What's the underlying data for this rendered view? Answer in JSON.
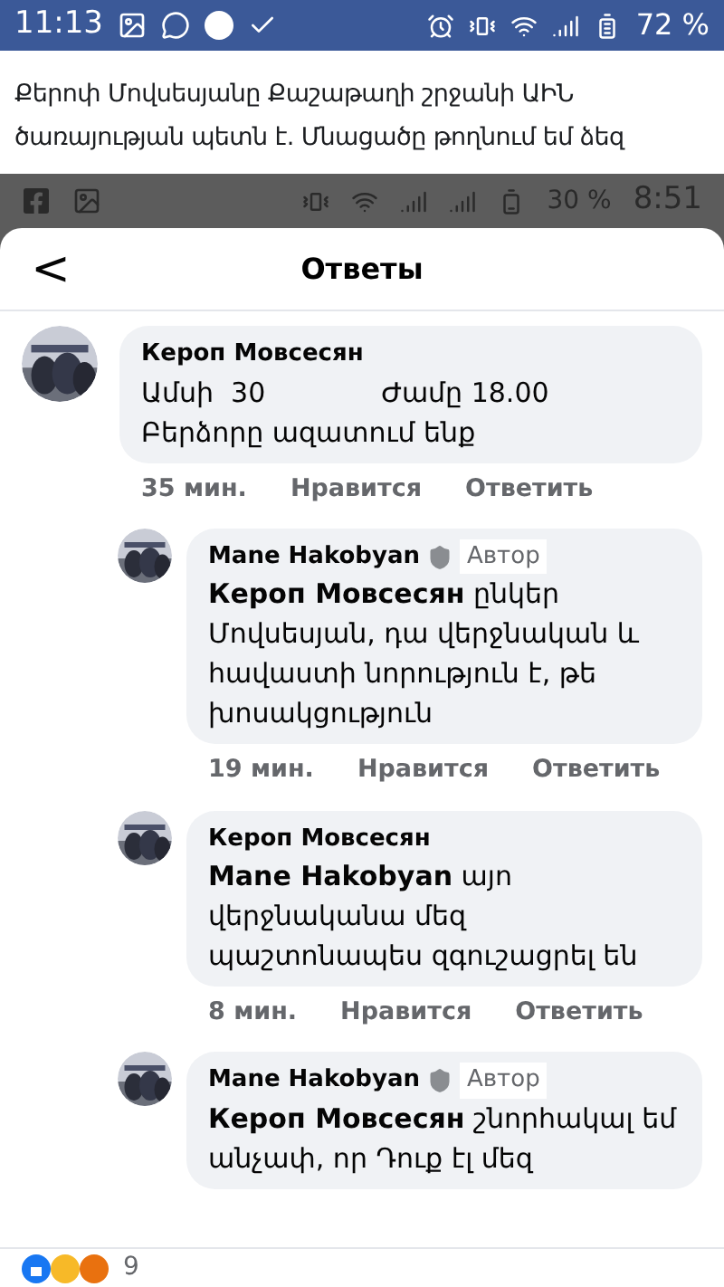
{
  "status_bar": {
    "time": "11:13",
    "battery": "72 %"
  },
  "post": {
    "text": "Քերոփ Մովսեսյանը Քաշաթաղի շրջանի ԱԻՆ ծառայության պետն է. Մնացածը թողնում եմ ձեզ"
  },
  "screenshot": {
    "status_bar": {
      "battery": "30 %",
      "time": "8:51"
    },
    "header": {
      "back": "<",
      "title": "Ответы"
    },
    "comments": [
      {
        "kind": "top",
        "author": "Кероп Мовсесян",
        "lines": [
          [
            "Ամսի  30",
            "Ժամը 18.00"
          ],
          [
            "Բերձորը ազատում ենք"
          ]
        ],
        "time": "35 мин.",
        "like": "Нравится",
        "reply": "Ответить"
      },
      {
        "kind": "reply",
        "author": "Mane Hakobyan",
        "badge": "Автор",
        "text": "**Кероп Мовсесян**  ընկեր Մովսեսյան, դա վերջնական և հավաստի նորություն է, թե խոսակցություն",
        "time": "19 мин.",
        "like": "Нравится",
        "reply": "Ответить"
      },
      {
        "kind": "reply",
        "author": "Кероп Мовсесян",
        "text": "**Mane Hakobyan** այո վերջնականա մեզ պաշտոնապես զգուշացրել են",
        "time": "8 мин.",
        "like": "Нравится",
        "reply": "Ответить"
      },
      {
        "kind": "reply",
        "author": "Mane Hakobyan",
        "badge": "Автор",
        "text": "**Кероп Мовсесян** շնորհակալ եմ անչափ, որ Դուք էլ մեզ"
      }
    ]
  },
  "reactions": {
    "count": "9"
  }
}
